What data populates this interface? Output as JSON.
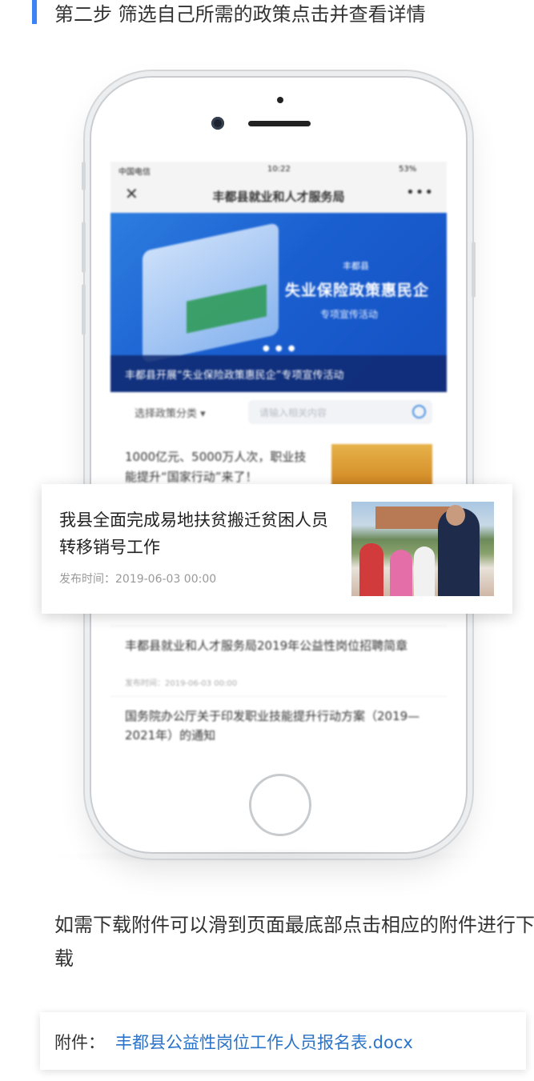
{
  "step": {
    "title": "第二步 筛选自己所需的政策点击并查看详情"
  },
  "phone": {
    "statusbar": {
      "carrier": "中国电信",
      "time": "10:22",
      "battery": "53%"
    },
    "navbar": {
      "close_icon": "close-icon",
      "title": "丰都县就业和人才服务局",
      "more_icon": "more-icon",
      "more_glyph": "•••"
    },
    "banner": {
      "small": "丰都县",
      "big": "失业保险政策惠民企",
      "sub": "专项宣传活动",
      "caption": "丰都县开展“失业保险政策惠民企”专项宣传活动"
    },
    "filter": {
      "category_label": "选择政策分类",
      "dropdown_glyph": "▾",
      "search_placeholder": "请输入相关内容"
    },
    "list": [
      {
        "title": "1000亿元、5000万人次，职业技能提升“国家行动”来了！"
      },
      {
        "title": "丰都县就业和人才服务局2019年公益性岗位招聘简章",
        "time": "发布时间：2019-06-03 00:00"
      },
      {
        "title": "国务院办公厅关于印发职业技能提升行动方案（2019—2021年）的通知"
      }
    ]
  },
  "highlight": {
    "title": "我县全面完成易地扶贫搬迁贫困人员转移销号工作",
    "time": "发布时间：2019-06-03 00:00"
  },
  "instruction": "如需下载附件可以滑到页面最底部点击相应的附件进行下载",
  "attachment": {
    "label": "附件：",
    "file": "丰都县公益性岗位工作人员报名表.docx"
  },
  "colors": {
    "accent": "#3b82f6",
    "link": "#2a73c8",
    "banner": "#1a5fd0"
  }
}
